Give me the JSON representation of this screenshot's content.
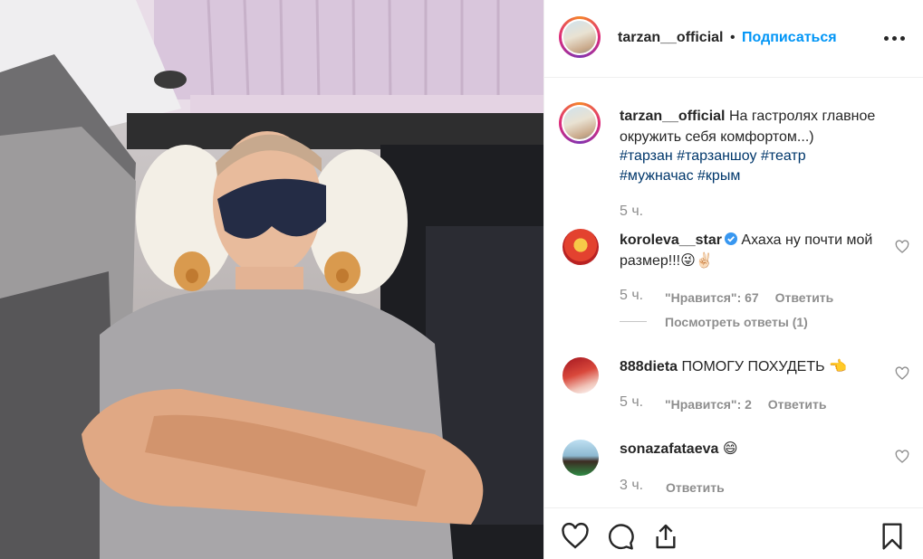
{
  "post": {
    "username": "tarzan__official",
    "separator": "•",
    "follow_label": "Подписаться",
    "caption_text": "На гастролях главное окружить себя комфортом...)",
    "hashtags": [
      "#тарзан",
      "#тарзаншоу",
      "#театр",
      "#мужначас",
      "#крым"
    ],
    "time": "5 ч."
  },
  "comments": [
    {
      "username": "koroleva__star",
      "verified": true,
      "text": "Ахаха ну почти мой размер!!!😜✌🏻",
      "time": "5 ч.",
      "likes_label": "\"Нравится\": 67",
      "reply_label": "Ответить",
      "view_replies": "Посмотреть ответы (1)"
    },
    {
      "username": "888dieta",
      "text": "ПОМОГУ ПОХУДЕТЬ 👈",
      "time": "5 ч.",
      "likes_label": "\"Нравится\": 2",
      "reply_label": "Ответить"
    },
    {
      "username": "sonazafataeva",
      "text": "😄",
      "time": "3 ч.",
      "reply_label": "Ответить"
    }
  ],
  "icons": [
    "more-icon",
    "heart-icon",
    "comment-icon",
    "share-icon",
    "bookmark-icon",
    "verified-icon"
  ],
  "colors": {
    "link": "#00376b",
    "follow": "#0095f6",
    "muted": "#8e8e8e",
    "text": "#262626"
  }
}
